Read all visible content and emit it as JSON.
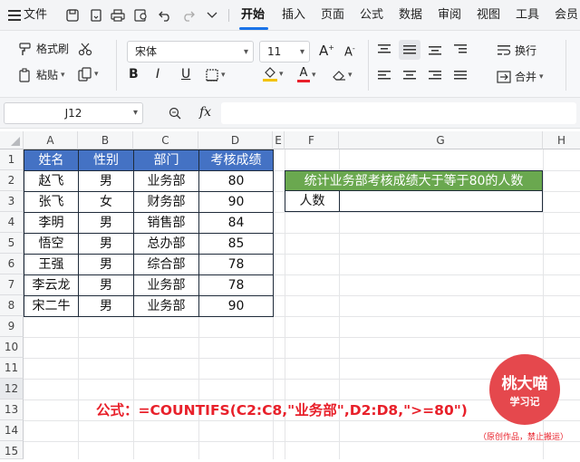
{
  "menubar": {
    "file_label": "文件",
    "tabs": [
      "开始",
      "插入",
      "页面",
      "公式",
      "数据",
      "审阅",
      "视图",
      "工具",
      "会员"
    ]
  },
  "ribbon": {
    "format_painter": "格式刷",
    "paste": "粘贴",
    "font_name": "宋体",
    "font_size": "11",
    "wrap_text": "换行",
    "merge": "合并",
    "font_color": "#e8202a",
    "fill_color": "#f2c200"
  },
  "formula_bar": {
    "name_box": "J12",
    "fx_label": "fx",
    "value": ""
  },
  "grid": {
    "columns": [
      "A",
      "B",
      "C",
      "D",
      "E",
      "F",
      "G",
      "H"
    ],
    "rows": [
      "1",
      "2",
      "3",
      "4",
      "5",
      "6",
      "7",
      "8",
      "9",
      "10",
      "11",
      "12",
      "13",
      "14",
      "15"
    ],
    "table": {
      "headers": [
        "姓名",
        "性别",
        "部门",
        "考核成绩"
      ],
      "rows": [
        [
          "赵飞",
          "男",
          "业务部",
          "80"
        ],
        [
          "张飞",
          "女",
          "财务部",
          "90"
        ],
        [
          "李明",
          "男",
          "销售部",
          "84"
        ],
        [
          "悟空",
          "男",
          "总办部",
          "85"
        ],
        [
          "王强",
          "男",
          "综合部",
          "78"
        ],
        [
          "李云龙",
          "男",
          "业务部",
          "78"
        ],
        [
          "宋二牛",
          "男",
          "业务部",
          "90"
        ]
      ]
    },
    "summary_title": "统计业务部考核成绩大于等于80的人数",
    "summary_label": "人数",
    "summary_value": ""
  },
  "overlay": {
    "formula_text": "公式：=COUNTIFS(C2:C8,\"业务部\",D2:D8,\">=80\")",
    "seal_title": "桃大喵",
    "seal_subtitle": "学习记",
    "copyright_note": "（原创作品，禁止搬运）"
  },
  "colors": {
    "header_blue": "#4472c4",
    "title_green": "#6aa84f",
    "accent": "#1a73e8",
    "formula_red": "#e8202a"
  }
}
